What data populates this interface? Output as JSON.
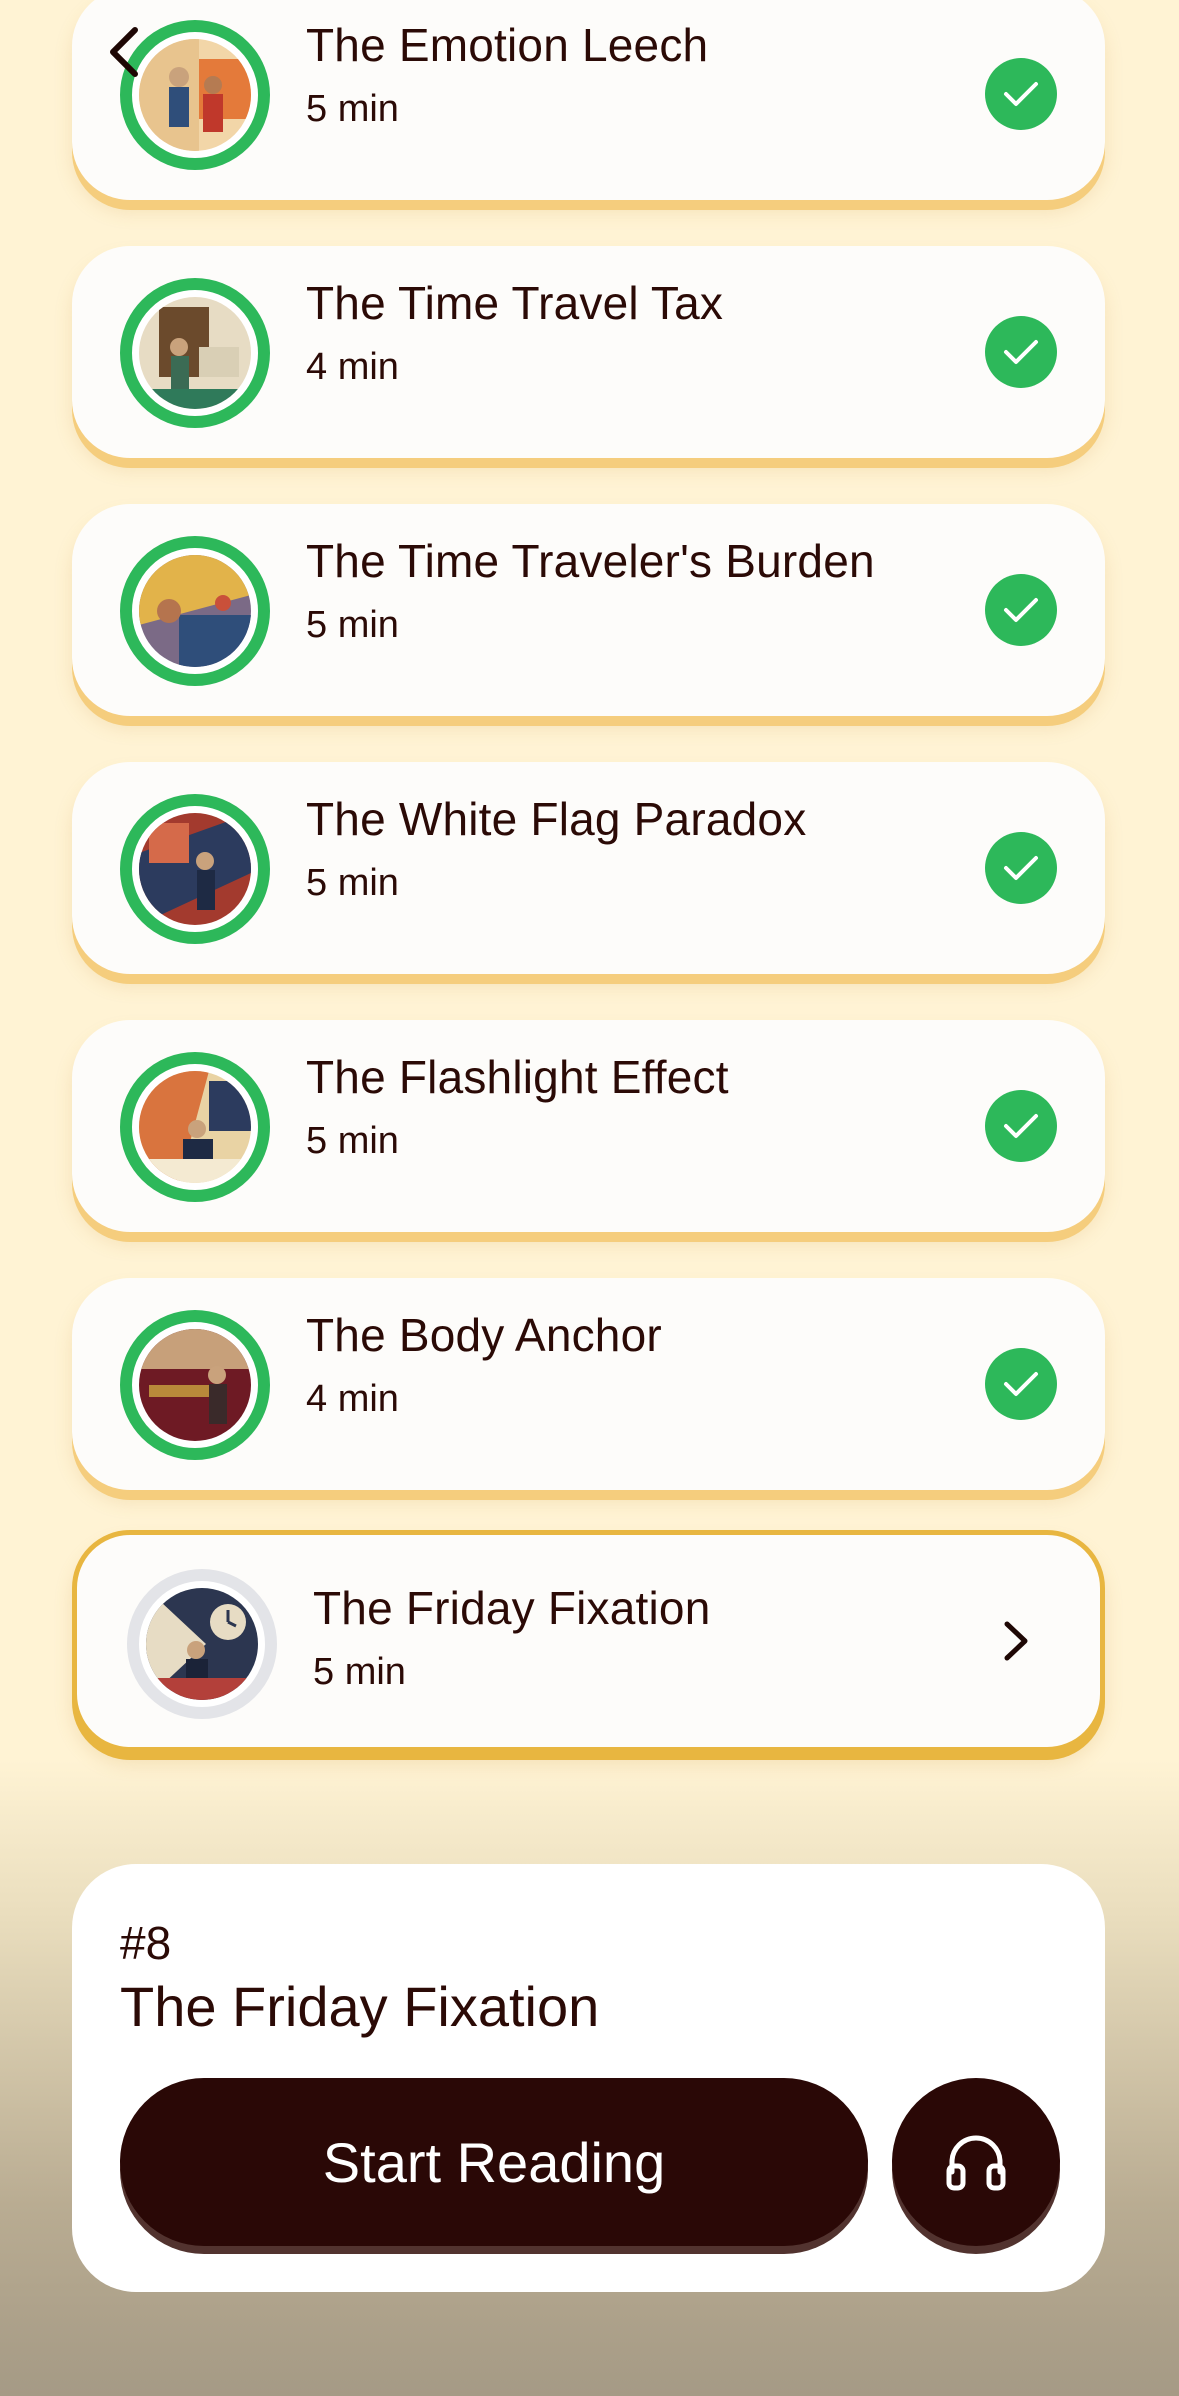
{
  "colors": {
    "background": "#fff3d4",
    "complete_green": "#2db85a",
    "current_border": "#e8b640",
    "dark_button": "#2a0806",
    "text": "#2b0a06"
  },
  "nav": {
    "back_icon": "chevron-left-icon"
  },
  "lessons": [
    {
      "title": "The Emotion Leech",
      "duration": "5 min",
      "status": "completed",
      "progress": 1
    },
    {
      "title": "The Time Travel Tax",
      "duration": "4 min",
      "status": "completed",
      "progress": 1
    },
    {
      "title": "The Time Traveler's Burden",
      "duration": "5 min",
      "status": "completed",
      "progress": 1
    },
    {
      "title": "The White Flag Paradox",
      "duration": "5 min",
      "status": "completed",
      "progress": 1
    },
    {
      "title": "The Flashlight Effect",
      "duration": "5 min",
      "status": "completed",
      "progress": 1
    },
    {
      "title": "The Body Anchor",
      "duration": "4 min",
      "status": "completed",
      "progress": 1
    },
    {
      "title": "The Friday Fixation",
      "duration": "5 min",
      "status": "current",
      "progress": 0
    }
  ],
  "panel": {
    "number": "#8",
    "title": "The Friday Fixation",
    "start_label": "Start Reading",
    "audio_icon": "headphones-icon"
  }
}
